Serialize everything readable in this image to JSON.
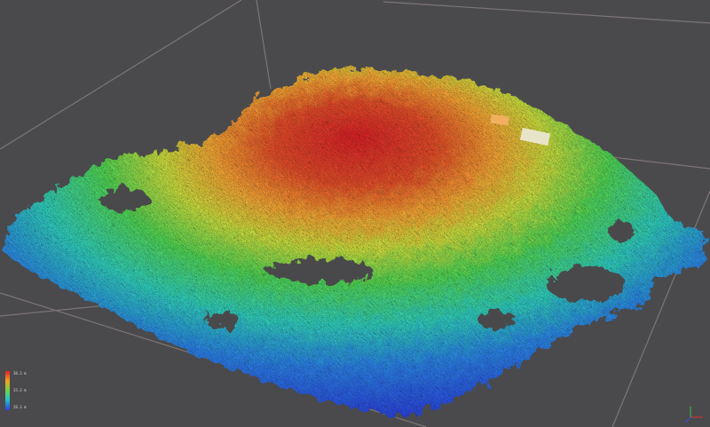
{
  "viewer": {
    "background": "#4a4a4c",
    "grid_color": "#8a7f80",
    "colormap": [
      "#2a3de0",
      "#25c6c6",
      "#6ed24a",
      "#f5d22a",
      "#e0202a"
    ]
  },
  "scalar_legend": {
    "max_label": "38.3 m",
    "mid_label": "33.3 m",
    "min_label": "28.3 m"
  }
}
